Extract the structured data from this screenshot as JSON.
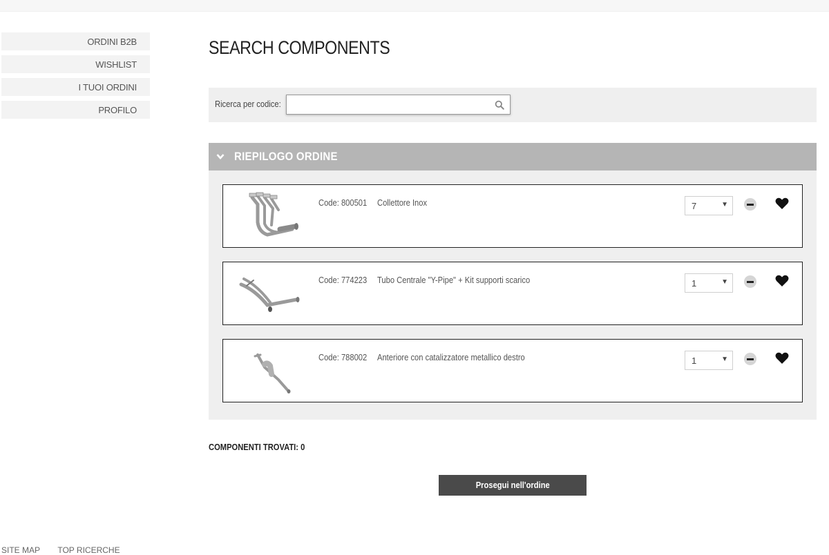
{
  "sidebar": {
    "items": [
      {
        "label": "ORDINI B2B"
      },
      {
        "label": "WISHLIST"
      },
      {
        "label": "I TUOI ORDINI"
      },
      {
        "label": "PROFILO"
      }
    ]
  },
  "page": {
    "title": "SEARCH COMPONENTS"
  },
  "search": {
    "label": "Ricerca per codice:",
    "value": "",
    "placeholder": ""
  },
  "summary": {
    "title": "RIEPILOGO ORDINE",
    "items": [
      {
        "code": "Code: 800501",
        "description": "Collettore Inox",
        "quantity": "7"
      },
      {
        "code": "Code: 774223",
        "description": "Tubo Centrale \"Y-Pipe\" + Kit supporti scarico",
        "quantity": "1"
      },
      {
        "code": "Code: 788002",
        "description": "Anteriore con catalizzatore metallico destro",
        "quantity": "1"
      }
    ]
  },
  "results": {
    "found_label": "COMPONENTI TROVATI: 0"
  },
  "actions": {
    "continue_label": "Prosegui nell'ordine"
  },
  "footer": {
    "links": [
      "SITE MAP",
      "TOP RICERCHE"
    ]
  },
  "icons": {
    "search": "search-icon",
    "chevron": "chevron-down-icon",
    "remove": "minus-circle-icon",
    "wishlist": "heart-icon"
  },
  "colors": {
    "summary_header": "#b5b5b5",
    "panel_bg": "#efefef",
    "button_bg": "#4a4a4a"
  }
}
